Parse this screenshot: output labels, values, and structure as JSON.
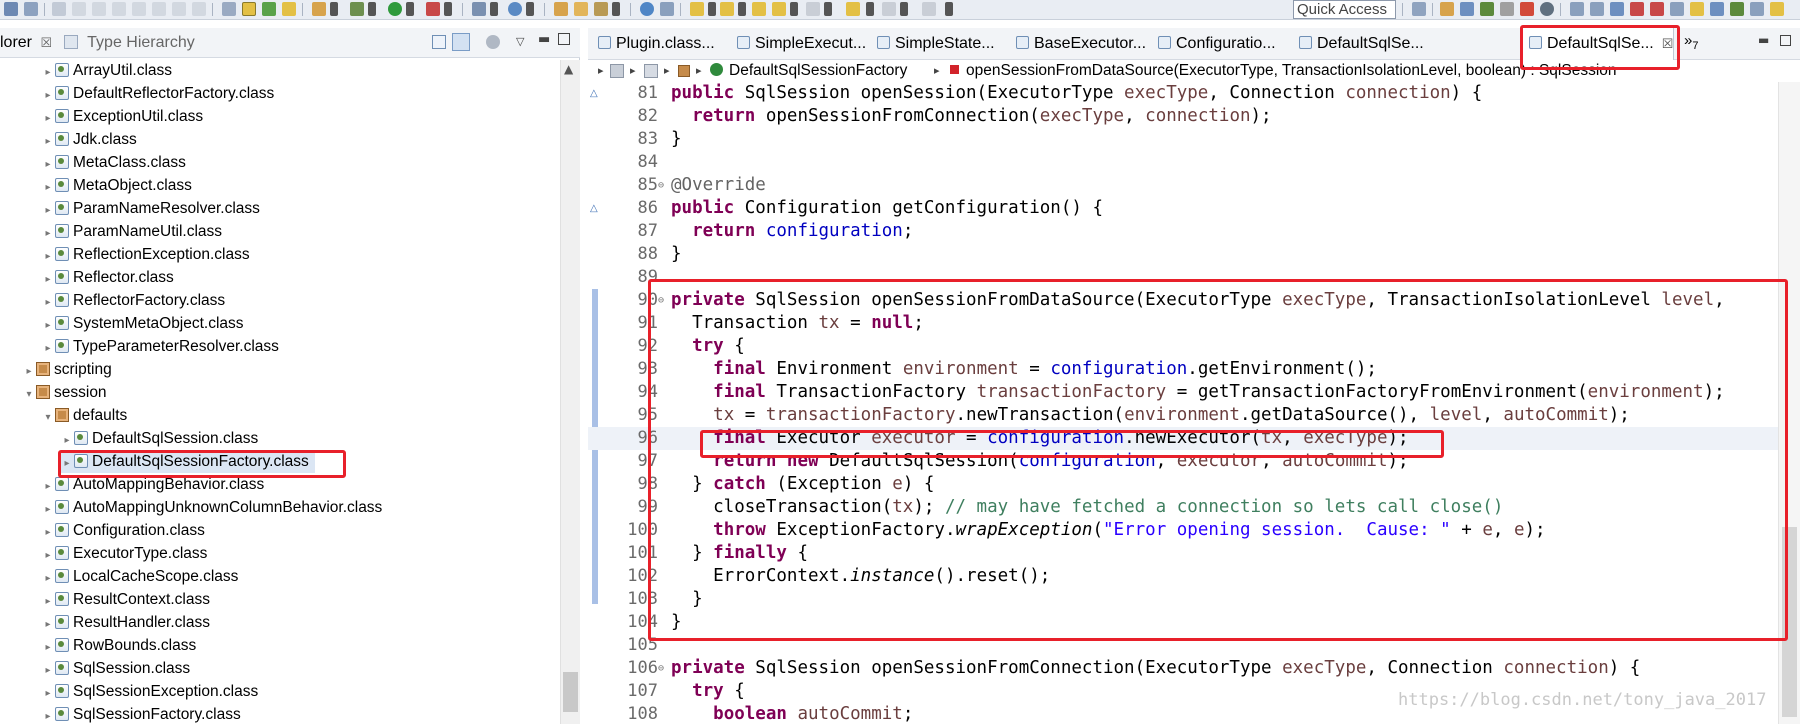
{
  "toolbar": {
    "quick_access_label": "Quick Access"
  },
  "left_panel": {
    "tabs": [
      {
        "label": "lorer",
        "close": "☒"
      },
      {
        "label": "Type Hierarchy"
      }
    ],
    "tree": [
      {
        "label": "ArrayUtil.class",
        "kind": "class",
        "indent": 1
      },
      {
        "label": "DefaultReflectorFactory.class",
        "kind": "class",
        "indent": 1
      },
      {
        "label": "ExceptionUtil.class",
        "kind": "class",
        "indent": 1
      },
      {
        "label": "Jdk.class",
        "kind": "class",
        "indent": 1
      },
      {
        "label": "MetaClass.class",
        "kind": "class",
        "indent": 1
      },
      {
        "label": "MetaObject.class",
        "kind": "class",
        "indent": 1
      },
      {
        "label": "ParamNameResolver.class",
        "kind": "class",
        "indent": 1
      },
      {
        "label": "ParamNameUtil.class",
        "kind": "class",
        "indent": 1
      },
      {
        "label": "ReflectionException.class",
        "kind": "class",
        "indent": 1
      },
      {
        "label": "Reflector.class",
        "kind": "class",
        "indent": 1
      },
      {
        "label": "ReflectorFactory.class",
        "kind": "class",
        "indent": 1
      },
      {
        "label": "SystemMetaObject.class",
        "kind": "class",
        "indent": 1
      },
      {
        "label": "TypeParameterResolver.class",
        "kind": "class",
        "indent": 1
      },
      {
        "label": "scripting",
        "kind": "package",
        "indent": 0
      },
      {
        "label": "session",
        "kind": "package",
        "indent": 0,
        "expanded": true
      },
      {
        "label": "defaults",
        "kind": "package",
        "indent": 1,
        "expanded": true
      },
      {
        "label": "DefaultSqlSession.class",
        "kind": "class",
        "indent": 2
      },
      {
        "label": "DefaultSqlSessionFactory.class",
        "kind": "class",
        "indent": 2,
        "selected": true
      },
      {
        "label": "AutoMappingBehavior.class",
        "kind": "class",
        "indent": 1
      },
      {
        "label": "AutoMappingUnknownColumnBehavior.class",
        "kind": "class",
        "indent": 1
      },
      {
        "label": "Configuration.class",
        "kind": "class",
        "indent": 1
      },
      {
        "label": "ExecutorType.class",
        "kind": "class",
        "indent": 1
      },
      {
        "label": "LocalCacheScope.class",
        "kind": "class",
        "indent": 1
      },
      {
        "label": "ResultContext.class",
        "kind": "class",
        "indent": 1
      },
      {
        "label": "ResultHandler.class",
        "kind": "class",
        "indent": 1
      },
      {
        "label": "RowBounds.class",
        "kind": "class",
        "indent": 1
      },
      {
        "label": "SqlSession.class",
        "kind": "class",
        "indent": 1
      },
      {
        "label": "SqlSessionException.class",
        "kind": "class",
        "indent": 1
      },
      {
        "label": "SqlSessionFactory.class",
        "kind": "class",
        "indent": 1
      }
    ]
  },
  "editor": {
    "tabs": [
      {
        "label": "Plugin.class..."
      },
      {
        "label": "SimpleExecut..."
      },
      {
        "label": "SimpleState..."
      },
      {
        "label": "BaseExecutor..."
      },
      {
        "label": "Configuratio..."
      },
      {
        "label": "DefaultSqlSe..."
      },
      {
        "label": "DefaultSqlSe...",
        "active": true
      }
    ],
    "more_tabs": "»",
    "more_tabs_count": "7",
    "breadcrumb": {
      "class_name": "DefaultSqlSessionFactory",
      "method": "openSessionFromDataSource(ExecutorType, TransactionIsolationLevel, boolean) : SqlSession"
    },
    "lines": [
      {
        "n": "81",
        "html": "<span class=\"kw\">public</span> SqlSession openSession(ExecutorType <span class=\"var\">execType</span>, Connection <span class=\"var\">connection</span>) {"
      },
      {
        "n": "82",
        "html": "  <span class=\"kw\">return</span> openSessionFromConnection(<span class=\"var\">execType</span>, <span class=\"var\">connection</span>);"
      },
      {
        "n": "83",
        "html": "}"
      },
      {
        "n": "84",
        "html": ""
      },
      {
        "n": "85",
        "html": "<span class=\"ann\">@Override</span>"
      },
      {
        "n": "86",
        "html": "<span class=\"kw\">public</span> Configuration getConfiguration() {"
      },
      {
        "n": "87",
        "html": "  <span class=\"kw\">return</span> <span class=\"fld\">configuration</span>;"
      },
      {
        "n": "88",
        "html": "}"
      },
      {
        "n": "89",
        "html": ""
      },
      {
        "n": "90",
        "html": "<span class=\"kw\">private</span> SqlSession openSessionFromDataSource(ExecutorType <span class=\"var\">execType</span>, TransactionIsolationLevel <span class=\"var\">level</span>,"
      },
      {
        "n": "91",
        "html": "  Transaction <span class=\"var\">tx</span> = <span class=\"kw\">null</span>;"
      },
      {
        "n": "92",
        "html": "  <span class=\"kw\">try</span> {"
      },
      {
        "n": "93",
        "html": "    <span class=\"kw\">final</span> Environment <span class=\"var\">environment</span> = <span class=\"fld\">configuration</span>.getEnvironment();"
      },
      {
        "n": "94",
        "html": "    <span class=\"kw\">final</span> TransactionFactory <span class=\"var\">transactionFactory</span> = getTransactionFactoryFromEnvironment(<span class=\"var\">environment</span>);"
      },
      {
        "n": "95",
        "html": "    <span class=\"var\">tx</span> = <span class=\"var\">transactionFactory</span>.newTransaction(<span class=\"var\">environment</span>.getDataSource(), <span class=\"var\">level</span>, <span class=\"var\">autoCommit</span>);"
      },
      {
        "n": "96",
        "html": "    <span class=\"kw\">final</span> Executor <span class=\"var\">executor</span> = <span class=\"fld\">configuration</span>.newExecutor(<span class=\"var\">tx</span>, <span class=\"var\">execType</span>);",
        "current": true
      },
      {
        "n": "97",
        "html": "    <span class=\"kw\">return</span> <span class=\"kw\">new</span> DefaultSqlSession(<span class=\"fld\">configuration</span>, <span class=\"var\">executor</span>, <span class=\"var\">autoCommit</span>);"
      },
      {
        "n": "98",
        "html": "  } <span class=\"kw\">catch</span> (Exception <span class=\"var\">e</span>) {"
      },
      {
        "n": "99",
        "html": "    closeTransaction(<span class=\"var\">tx</span>); <span class=\"cmt\">// may have fetched a connection so lets call close()</span>"
      },
      {
        "n": "100",
        "html": "    <span class=\"kw\">throw</span> ExceptionFactory.<span class=\"ita\">wrapException</span>(<span class=\"str\">\"Error opening session.  Cause: \"</span> + <span class=\"var\">e</span>, <span class=\"var\">e</span>);"
      },
      {
        "n": "101",
        "html": "  } <span class=\"kw\">finally</span> {"
      },
      {
        "n": "102",
        "html": "    ErrorContext.<span class=\"ita\">instance</span>().reset();"
      },
      {
        "n": "103",
        "html": "  }"
      },
      {
        "n": "104",
        "html": "}"
      },
      {
        "n": "105",
        "html": ""
      },
      {
        "n": "106",
        "html": "<span class=\"kw\">private</span> SqlSession openSessionFromConnection(ExecutorType <span class=\"var\">execType</span>, Connection <span class=\"var\">connection</span>) {"
      },
      {
        "n": "107",
        "html": "  <span class=\"kw\">try</span> {"
      },
      {
        "n": "108",
        "html": "    <span class=\"kw\">boolean</span> <span class=\"var\">autoCommit</span>;"
      }
    ]
  },
  "watermark": "https://blog.csdn.net/tony_java_2017",
  "colors": {
    "highlight_box": "#e8202a",
    "keyword": "#7f0055",
    "field": "#0000c0",
    "local_var": "#6a3e3e",
    "string": "#2a00ff",
    "comment": "#3f7f5f"
  }
}
